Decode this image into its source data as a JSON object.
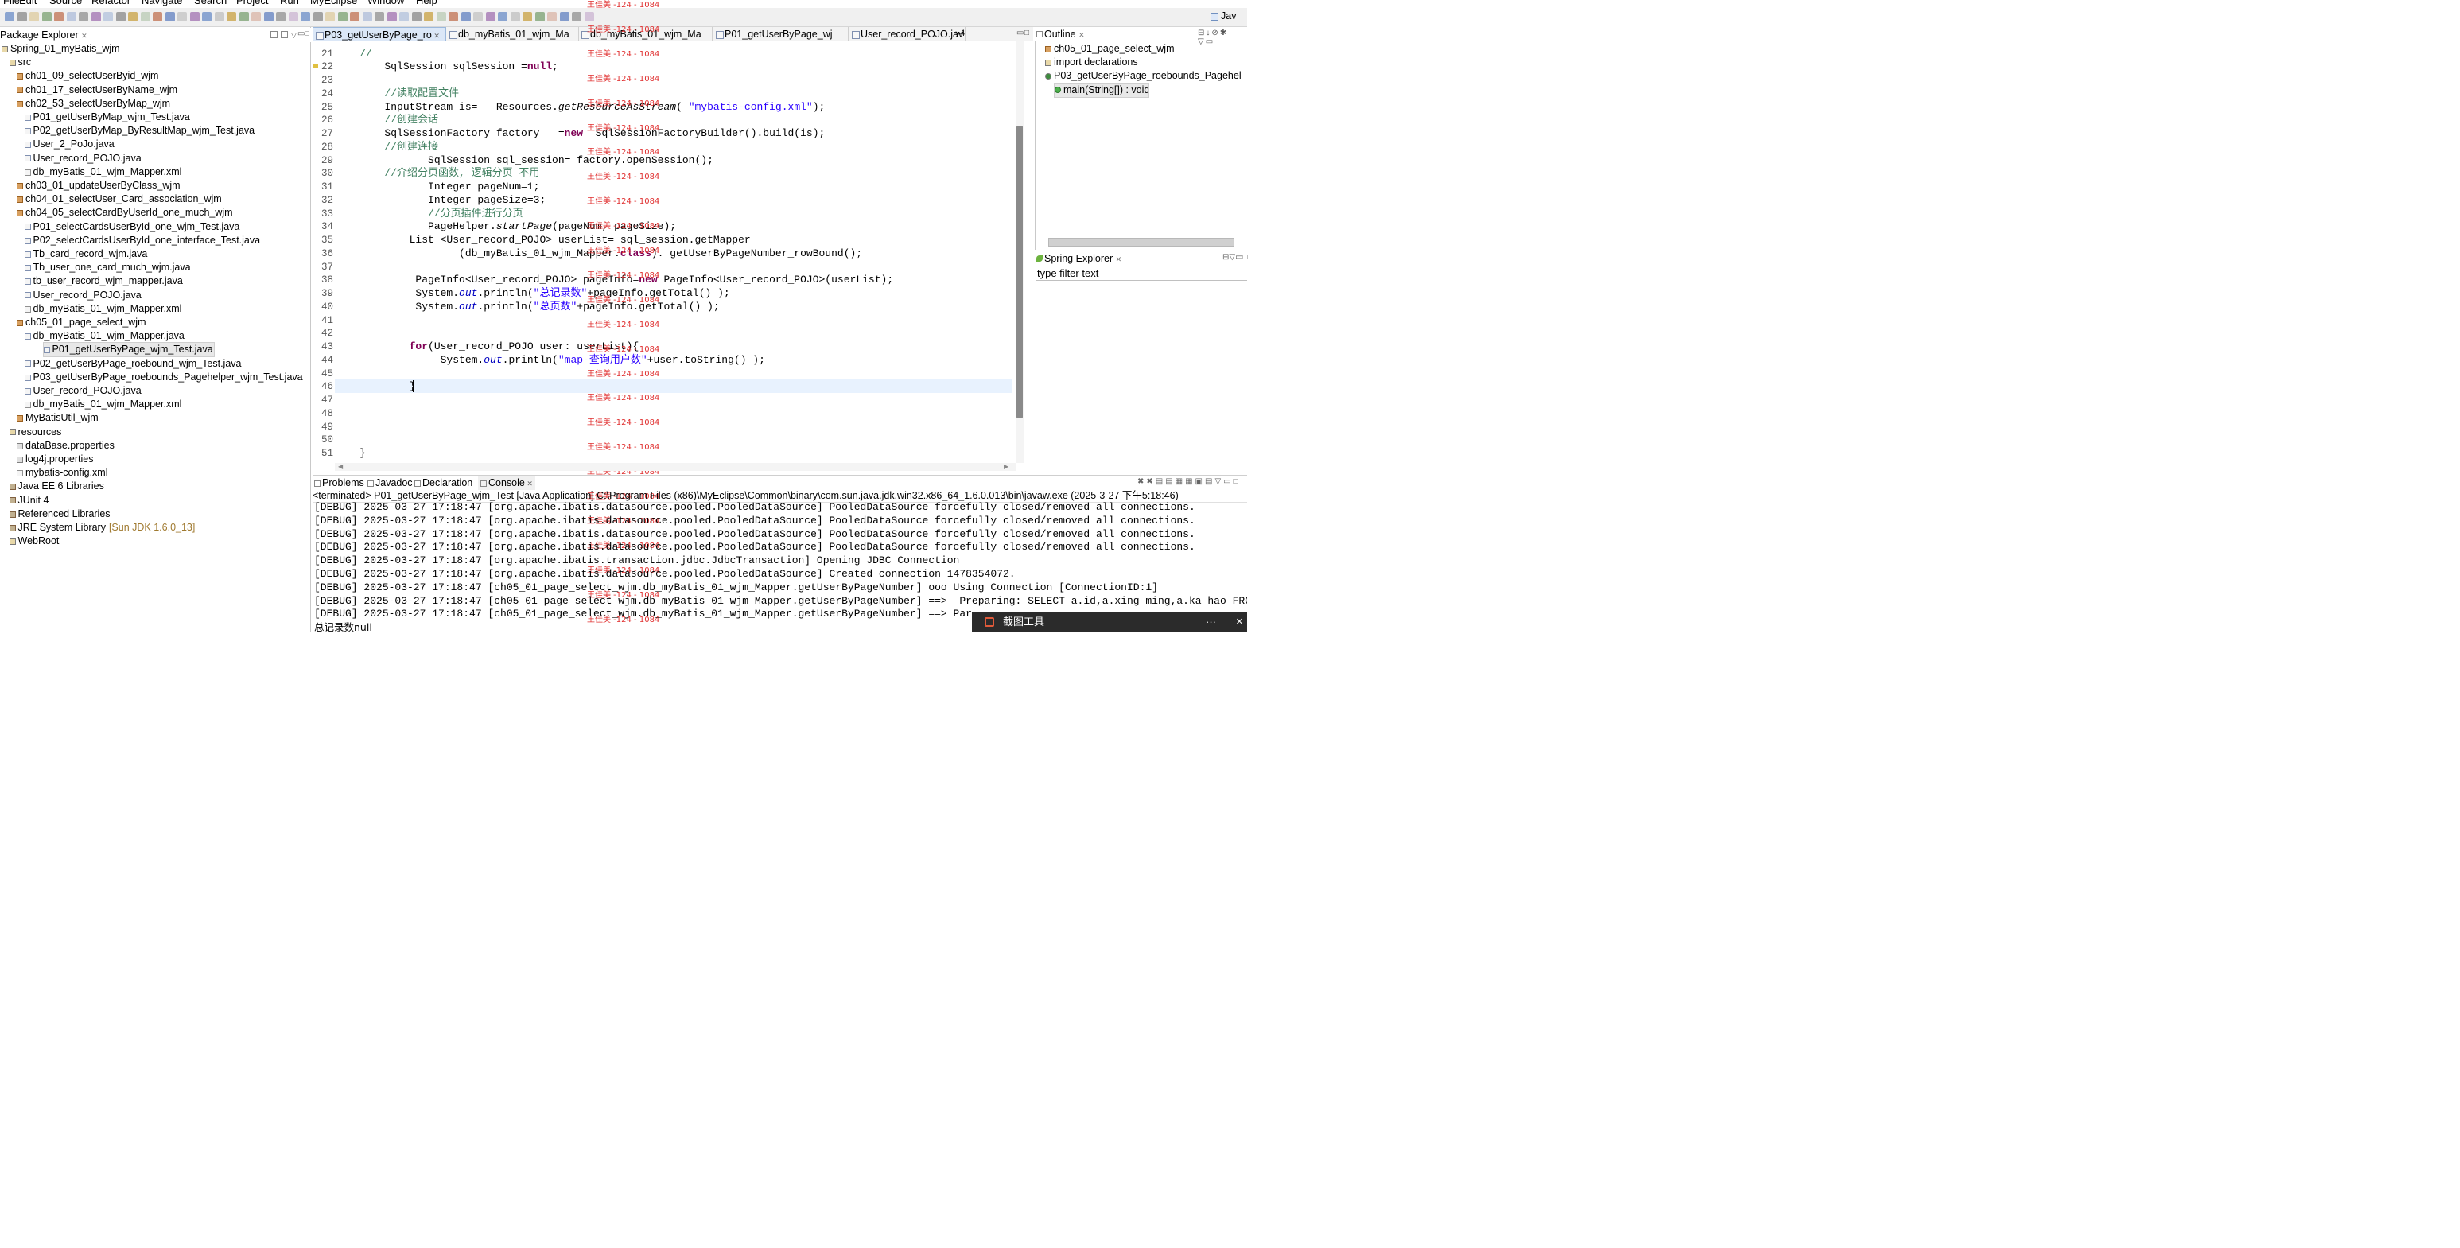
{
  "menu": [
    "File",
    "Edit",
    "Source",
    "Refactor",
    "Navigate",
    "Search",
    "Project",
    "Run",
    "MyEclipse",
    "Window",
    "Help"
  ],
  "perspective": "Jav",
  "package_explorer": {
    "title": "Package Explorer",
    "items": [
      {
        "text": "Spring_01_myBatis_wjm",
        "indent": 0,
        "icon": "project-icon"
      },
      {
        "text": "src",
        "indent": 1,
        "icon": "source-folder-icon"
      },
      {
        "text": "ch01_09_selectUserByid_wjm",
        "indent": 2,
        "icon": "package-icon"
      },
      {
        "text": "ch01_17_selectUserByName_wjm",
        "indent": 2,
        "icon": "package-icon"
      },
      {
        "text": "ch02_53_selectUserByMap_wjm",
        "indent": 2,
        "icon": "package-icon"
      },
      {
        "text": "P01_getUserByMap_wjm_Test.java",
        "indent": 3,
        "icon": "java-file-icon"
      },
      {
        "text": "P02_getUserByMap_ByResultMap_wjm_Test.java",
        "indent": 3,
        "icon": "java-file-icon"
      },
      {
        "text": "User_2_PoJo.java",
        "indent": 3,
        "icon": "java-file-icon"
      },
      {
        "text": "User_record_POJO.java",
        "indent": 3,
        "icon": "java-file-icon"
      },
      {
        "text": "db_myBatis_01_wjm_Mapper.xml",
        "indent": 3,
        "icon": "xml-file-icon"
      },
      {
        "text": "ch03_01_updateUserByClass_wjm",
        "indent": 2,
        "icon": "package-icon"
      },
      {
        "text": "ch04_01_selectUser_Card_association_wjm",
        "indent": 2,
        "icon": "package-icon"
      },
      {
        "text": "ch04_05_selectCardByUserId_one_much_wjm",
        "indent": 2,
        "icon": "package-icon"
      },
      {
        "text": "P01_selectCardsUserById_one_wjm_Test.java",
        "indent": 3,
        "icon": "java-file-icon"
      },
      {
        "text": "P02_selectCardsUserById_one_interface_Test.java",
        "indent": 3,
        "icon": "java-file-icon"
      },
      {
        "text": "Tb_card_record_wjm.java",
        "indent": 3,
        "icon": "java-file-icon"
      },
      {
        "text": "Tb_user_one_card_much_wjm.java",
        "indent": 3,
        "icon": "java-file-icon"
      },
      {
        "text": "tb_user_record_wjm_mapper.java",
        "indent": 3,
        "icon": "java-file-icon"
      },
      {
        "text": "User_record_POJO.java",
        "indent": 3,
        "icon": "java-file-icon"
      },
      {
        "text": "db_myBatis_01_wjm_Mapper.xml",
        "indent": 3,
        "icon": "xml-file-icon"
      },
      {
        "text": "ch05_01_page_select_wjm",
        "indent": 2,
        "icon": "package-icon"
      },
      {
        "text": "db_myBatis_01_wjm_Mapper.java",
        "indent": 3,
        "icon": "java-file-icon"
      },
      {
        "text": "P01_getUserByPage_wjm_Test.java",
        "indent": 3,
        "icon": "java-file-icon",
        "selected": true
      },
      {
        "text": "P02_getUserByPage_roebound_wjm_Test.java",
        "indent": 3,
        "icon": "java-file-icon"
      },
      {
        "text": "P03_getUserByPage_roebounds_Pagehelper_wjm_Test.java",
        "indent": 3,
        "icon": "java-file-icon"
      },
      {
        "text": "User_record_POJO.java",
        "indent": 3,
        "icon": "java-file-icon"
      },
      {
        "text": "db_myBatis_01_wjm_Mapper.xml",
        "indent": 3,
        "icon": "xml-file-icon"
      },
      {
        "text": "MyBatisUtil_wjm",
        "indent": 2,
        "icon": "package-icon"
      },
      {
        "text": "resources",
        "indent": 1,
        "icon": "folder-icon"
      },
      {
        "text": "dataBase.properties",
        "indent": 2,
        "icon": "properties-file-icon"
      },
      {
        "text": "log4j.properties",
        "indent": 2,
        "icon": "properties-file-icon"
      },
      {
        "text": "mybatis-config.xml",
        "indent": 2,
        "icon": "xml-file-icon"
      },
      {
        "text": "Java EE 6 Libraries",
        "indent": 1,
        "icon": "library-icon"
      },
      {
        "text": "JUnit 4",
        "indent": 1,
        "icon": "library-icon"
      },
      {
        "text": "Referenced Libraries",
        "indent": 1,
        "icon": "library-icon"
      },
      {
        "text": "JRE System Library",
        "suffix": "[Sun JDK 1.6.0_13]",
        "indent": 1,
        "icon": "library-icon"
      },
      {
        "text": "WebRoot",
        "indent": 1,
        "icon": "folder-icon"
      }
    ]
  },
  "editor": {
    "tabs": [
      "P03_getUserByPage_ro",
      "db_myBatis_01_wjm_Ma",
      "db_myBatis_01_wjm_Ma",
      "P01_getUserByPage_wj",
      "User_record_POJO.jav"
    ],
    "overflow_count": "4",
    "watermark": "王佳美 -124 - 1084",
    "lines": [
      {
        "n": "21",
        "s": [
          [
            "cm",
            "    //"
          ]
        ]
      },
      {
        "n": "22",
        "s": [
          [
            "",
            "        SqlSession sqlSession ="
          ],
          [
            "kw",
            "null"
          ],
          [
            "",
            ";"
          ]
        ]
      },
      {
        "n": "23",
        "s": []
      },
      {
        "n": "24",
        "s": [
          [
            "cm",
            "        //读取配置文件"
          ]
        ]
      },
      {
        "n": "25",
        "s": [
          [
            "",
            "        InputStream is=   Resources."
          ],
          [
            "it",
            "getResourceAsStream"
          ],
          [
            "",
            "( "
          ],
          [
            "st",
            "\"mybatis-config.xml\""
          ],
          [
            "",
            ");"
          ]
        ]
      },
      {
        "n": "26",
        "s": [
          [
            "cm",
            "        //创建会话"
          ]
        ]
      },
      {
        "n": "27",
        "s": [
          [
            "",
            "        SqlSessionFactory factory   ="
          ],
          [
            "kw",
            "new"
          ],
          [
            "",
            "  SqlSessionFactoryBuilder().build(is);"
          ]
        ]
      },
      {
        "n": "28",
        "s": [
          [
            "cm",
            "        //创建连接"
          ]
        ]
      },
      {
        "n": "29",
        "s": [
          [
            "",
            "               SqlSession sql_session= factory.openSession();"
          ]
        ]
      },
      {
        "n": "30",
        "s": [
          [
            "cm",
            "        //介绍分页函数, 逻辑分页 不用"
          ]
        ]
      },
      {
        "n": "31",
        "s": [
          [
            "",
            "               Integer pageNum=1;"
          ]
        ]
      },
      {
        "n": "32",
        "s": [
          [
            "",
            "               Integer pageSize=3;"
          ]
        ]
      },
      {
        "n": "33",
        "s": [
          [
            "cm",
            "               //分页插件进行分页"
          ]
        ]
      },
      {
        "n": "34",
        "s": [
          [
            "",
            "               PageHelper."
          ],
          [
            "it",
            "startPage"
          ],
          [
            "",
            "(pageNum, pageSize);"
          ]
        ]
      },
      {
        "n": "35",
        "s": [
          [
            "",
            "            List <User_record_POJO> userList= sql_session.getMapper"
          ]
        ]
      },
      {
        "n": "36",
        "s": [
          [
            "",
            "                    (db_myBatis_01_wjm_Mapper."
          ],
          [
            "kw",
            "class"
          ],
          [
            "",
            "). getUserByPageNumber_rowBound();"
          ]
        ]
      },
      {
        "n": "37",
        "s": []
      },
      {
        "n": "38",
        "s": [
          [
            "",
            "             PageInfo<User_record_POJO> pageInfo="
          ],
          [
            "kw",
            "new"
          ],
          [
            "",
            " PageInfo<User_record_POJO>(userList);"
          ]
        ]
      },
      {
        "n": "39",
        "s": [
          [
            "",
            "             System."
          ],
          [
            "fl",
            "out"
          ],
          [
            "",
            ".println("
          ],
          [
            "st",
            "\"总记录数\""
          ],
          [
            "",
            "+pageInfo.getTotal() );"
          ]
        ]
      },
      {
        "n": "40",
        "s": [
          [
            "",
            "             System."
          ],
          [
            "fl",
            "out"
          ],
          [
            "",
            ".println("
          ],
          [
            "st",
            "\"总页数\""
          ],
          [
            "",
            "+pageInfo.getTotal() );"
          ]
        ]
      },
      {
        "n": "41",
        "s": []
      },
      {
        "n": "42",
        "s": []
      },
      {
        "n": "43",
        "s": [
          [
            "",
            "            "
          ],
          [
            "kw",
            "for"
          ],
          [
            "",
            "(User_record_POJO user: userList){"
          ]
        ]
      },
      {
        "n": "44",
        "s": [
          [
            "",
            "                 System."
          ],
          [
            "fl",
            "out"
          ],
          [
            "",
            ".println("
          ],
          [
            "st",
            "\"map-查询用户数\""
          ],
          [
            "",
            "+user.toString() );"
          ]
        ]
      },
      {
        "n": "45",
        "s": []
      },
      {
        "n": "46",
        "s": [
          [
            "",
            "            }"
          ]
        ]
      },
      {
        "n": "47",
        "s": []
      },
      {
        "n": "48",
        "s": []
      },
      {
        "n": "49",
        "s": []
      },
      {
        "n": "50",
        "s": []
      },
      {
        "n": "51",
        "s": [
          [
            "",
            "    }"
          ]
        ]
      }
    ]
  },
  "outline": {
    "title": "Outline",
    "items": [
      {
        "text": "ch05_01_page_select_wjm",
        "indent": 0,
        "icon": "package-icon"
      },
      {
        "text": "import declarations",
        "indent": 0,
        "icon": "import-icon"
      },
      {
        "text": "P03_getUserByPage_roebounds_Pagehel",
        "indent": 0,
        "icon": "class-icon"
      },
      {
        "text": "main(String[]) : void",
        "indent": 1,
        "icon": "method-icon",
        "selected": true
      }
    ]
  },
  "spring_explorer": {
    "title": "Spring Explorer",
    "filter_placeholder": "type filter text"
  },
  "console": {
    "tabs": [
      "Problems",
      "Javadoc",
      "Declaration",
      "Console"
    ],
    "status": "<terminated> P01_getUserByPage_wjm_Test [Java Application] C:\\Program Files (x86)\\MyEclipse\\Common\\binary\\com.sun.java.jdk.win32.x86_64_1.6.0.013\\bin\\javaw.exe (2025-3-27 下午5:18:46)",
    "lines": [
      "[DEBUG] 2025-03-27 17:18:47 [org.apache.ibatis.datasource.pooled.PooledDataSource] PooledDataSource forcefully closed/removed all connections.",
      "[DEBUG] 2025-03-27 17:18:47 [org.apache.ibatis.datasource.pooled.PooledDataSource] PooledDataSource forcefully closed/removed all connections.",
      "[DEBUG] 2025-03-27 17:18:47 [org.apache.ibatis.datasource.pooled.PooledDataSource] PooledDataSource forcefully closed/removed all connections.",
      "[DEBUG] 2025-03-27 17:18:47 [org.apache.ibatis.datasource.pooled.PooledDataSource] PooledDataSource forcefully closed/removed all connections.",
      "[DEBUG] 2025-03-27 17:18:47 [org.apache.ibatis.transaction.jdbc.JdbcTransaction] Opening JDBC Connection",
      "[DEBUG] 2025-03-27 17:18:47 [org.apache.ibatis.datasource.pooled.PooledDataSource] Created connection 1478354072.",
      "[DEBUG] 2025-03-27 17:18:47 [ch05_01_page_select_wjm.db_myBatis_01_wjm_Mapper.getUserByPageNumber] ooo Using Connection [ConnectionID:1]",
      "[DEBUG] 2025-03-27 17:18:47 [ch05_01_page_select_wjm.db_myBatis_01_wjm_Mapper.getUserByPageNumber] ==>  Preparing: SELECT a.id,a.xing_ming,a.ka_hao FROM u",
      "[DEBUG] 2025-03-27 17:18:47 [ch05_01_page_select_wjm.db_myBatis_01_wjm_Mapper.getUserByPageNumber] ==> Parame",
      "总记录数null"
    ]
  },
  "toast": {
    "title": "截图工具",
    "more": "···",
    "close": "×"
  }
}
